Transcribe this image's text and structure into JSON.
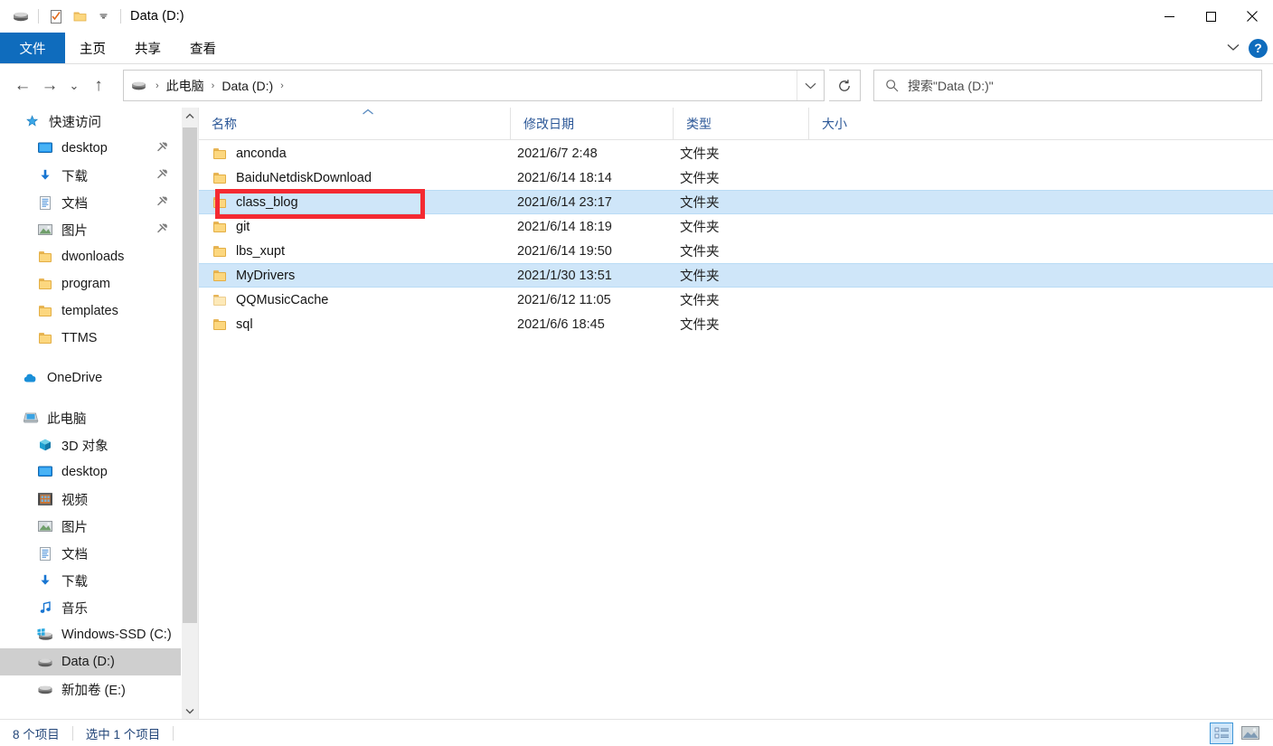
{
  "window": {
    "title": "Data (D:)",
    "quick_access": [
      {
        "name": "drive-icon",
        "tip": "Data (D:)"
      },
      {
        "name": "properties-icon",
        "tip": "属性"
      },
      {
        "name": "new-folder-icon",
        "tip": "新建文件夹"
      },
      {
        "name": "customize-qat-chevron-icon",
        "tip": "自定义快速访问工具栏"
      }
    ],
    "controls": {
      "minimize": "—",
      "maximize": "□",
      "close": "✕"
    }
  },
  "ribbon": {
    "tabs": [
      {
        "label": "文件",
        "active": true
      },
      {
        "label": "主页",
        "active": false
      },
      {
        "label": "共享",
        "active": false
      },
      {
        "label": "查看",
        "active": false
      }
    ],
    "collapse_icon": "chevron-down-icon",
    "help_label": "?"
  },
  "navbar": {
    "back": "←",
    "forward": "→",
    "recent": "⌄",
    "up": "↑",
    "breadcrumb": {
      "icon": "drive-icon",
      "items": [
        "此电脑",
        "Data (D:)"
      ],
      "separator": "›"
    },
    "dropdown_icon": "chevron-down-icon",
    "refresh_icon": "refresh-icon"
  },
  "search": {
    "icon": "search-icon",
    "placeholder": "搜索\"Data (D:)\"",
    "value": ""
  },
  "sidebar": {
    "groups": [
      {
        "header": {
          "label": "快速访问",
          "icon": "star-pin-icon"
        },
        "items": [
          {
            "label": "desktop",
            "icon": "desktop-icon",
            "pinned": true
          },
          {
            "label": "下载",
            "icon": "downloads-icon",
            "pinned": true
          },
          {
            "label": "文档",
            "icon": "documents-icon",
            "pinned": true
          },
          {
            "label": "图片",
            "icon": "pictures-icon",
            "pinned": true
          },
          {
            "label": "dwonloads",
            "icon": "folder-icon",
            "pinned": false
          },
          {
            "label": "program",
            "icon": "folder-icon",
            "pinned": false
          },
          {
            "label": "templates",
            "icon": "folder-icon",
            "pinned": false
          },
          {
            "label": "TTMS",
            "icon": "folder-icon",
            "pinned": false
          }
        ]
      },
      {
        "header": {
          "label": "OneDrive",
          "icon": "onedrive-icon"
        },
        "items": []
      },
      {
        "header": {
          "label": "此电脑",
          "icon": "this-pc-icon"
        },
        "items": [
          {
            "label": "3D 对象",
            "icon": "3d-objects-icon",
            "pinned": false
          },
          {
            "label": "desktop",
            "icon": "desktop-icon",
            "pinned": false
          },
          {
            "label": "视频",
            "icon": "videos-icon",
            "pinned": false
          },
          {
            "label": "图片",
            "icon": "pictures-icon",
            "pinned": false
          },
          {
            "label": "文档",
            "icon": "documents-icon",
            "pinned": false
          },
          {
            "label": "下载",
            "icon": "downloads-icon",
            "pinned": false
          },
          {
            "label": "音乐",
            "icon": "music-icon",
            "pinned": false
          },
          {
            "label": "Windows-SSD (C:)",
            "icon": "windows-drive-icon",
            "pinned": false
          },
          {
            "label": "Data (D:)",
            "icon": "drive-icon",
            "pinned": false,
            "selected": true
          },
          {
            "label": "新加卷 (E:)",
            "icon": "drive-icon",
            "pinned": false
          }
        ]
      }
    ]
  },
  "filelist": {
    "columns": [
      {
        "label": "名称",
        "sorted": true,
        "sort_dir": "asc"
      },
      {
        "label": "修改日期"
      },
      {
        "label": "类型"
      },
      {
        "label": "大小"
      }
    ],
    "rows": [
      {
        "name": "anconda",
        "date": "2021/6/7 2:48",
        "type": "文件夹",
        "size": "",
        "icon": "folder-icon",
        "selected": false
      },
      {
        "name": "BaiduNetdiskDownload",
        "date": "2021/6/14 18:14",
        "type": "文件夹",
        "size": "",
        "icon": "folder-icon",
        "selected": false
      },
      {
        "name": "class_blog",
        "date": "2021/6/14 23:17",
        "type": "文件夹",
        "size": "",
        "icon": "folder-icon",
        "selected": true
      },
      {
        "name": "git",
        "date": "2021/6/14 18:19",
        "type": "文件夹",
        "size": "",
        "icon": "folder-icon",
        "selected": false
      },
      {
        "name": "lbs_xupt",
        "date": "2021/6/14 19:50",
        "type": "文件夹",
        "size": "",
        "icon": "folder-icon",
        "selected": false
      },
      {
        "name": "MyDrivers",
        "date": "2021/1/30 13:51",
        "type": "文件夹",
        "size": "",
        "icon": "folder-icon",
        "selected": true
      },
      {
        "name": "QQMusicCache",
        "date": "2021/6/12 11:05",
        "type": "文件夹",
        "size": "",
        "icon": "folder-icon-pale",
        "selected": false
      },
      {
        "name": "sql",
        "date": "2021/6/6 18:45",
        "type": "文件夹",
        "size": "",
        "icon": "folder-icon",
        "selected": false
      }
    ]
  },
  "annotation": {
    "target": "class_blog",
    "color": "#f42a32"
  },
  "statusbar": {
    "item_count": "8 个项目",
    "selection": "选中 1 个项目",
    "views": [
      {
        "name": "details-view-button",
        "active": true
      },
      {
        "name": "large-icons-view-button",
        "active": false
      }
    ]
  },
  "colors": {
    "accent": "#0f6cbd",
    "selection": "#cfe6f9",
    "header_text": "#2b5797",
    "annotation": "#f42a32"
  }
}
